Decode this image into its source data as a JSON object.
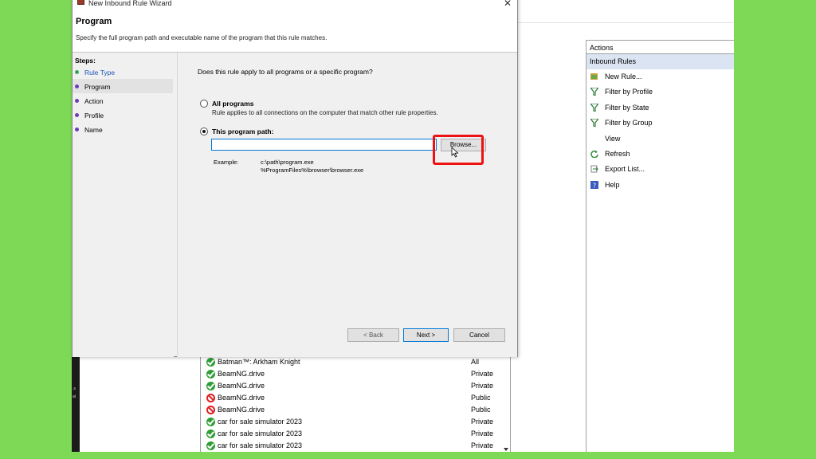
{
  "wizard": {
    "window_title": "New Inbound Rule Wizard",
    "close_glyph": "✕",
    "heading": "Program",
    "description": "Specify the full program path and executable name of the program that this rule matches.",
    "steps_label": "Steps:",
    "steps": [
      {
        "label": "Rule Type",
        "state": "done"
      },
      {
        "label": "Program",
        "state": "current"
      },
      {
        "label": "Action",
        "state": "todo"
      },
      {
        "label": "Profile",
        "state": "todo"
      },
      {
        "label": "Name",
        "state": "todo"
      }
    ],
    "question": "Does this rule apply to all programs or a specific program?",
    "option_all": {
      "label": "All programs",
      "description": "Rule applies to all connections on the computer that match other rule properties.",
      "selected": false
    },
    "option_path": {
      "label": "This program path:",
      "selected": true
    },
    "path_value": "",
    "browse_label": "Browse...",
    "example_label": "Example:",
    "example_1": "c:\\path\\program.exe",
    "example_2": "%ProgramFiles%\\browser\\browser.exe",
    "back_label": "< Back",
    "next_label": "Next >",
    "cancel_label": "Cancel",
    "highlight_color": "#ee1111"
  },
  "actions_pane": {
    "header": "Actions",
    "group": "Inbound Rules",
    "items": [
      {
        "label": "New Rule...",
        "icon": "new-rule-icon",
        "submenu": false
      },
      {
        "label": "Filter by Profile",
        "icon": "filter-icon",
        "submenu": true
      },
      {
        "label": "Filter by State",
        "icon": "filter-icon",
        "submenu": true
      },
      {
        "label": "Filter by Group",
        "icon": "filter-icon",
        "submenu": true
      },
      {
        "label": "View",
        "icon": "",
        "submenu": true
      },
      {
        "label": "Refresh",
        "icon": "refresh-icon",
        "submenu": false
      },
      {
        "label": "Export List...",
        "icon": "export-icon",
        "submenu": false
      },
      {
        "label": "Help",
        "icon": "help-icon",
        "submenu": false
      }
    ]
  },
  "rules": [
    {
      "name": "Batman™: Arkham Knight",
      "profile": "All",
      "enabled": true
    },
    {
      "name": "BeamNG.drive",
      "profile": "Private",
      "enabled": true
    },
    {
      "name": "BeamNG.drive",
      "profile": "Private",
      "enabled": true
    },
    {
      "name": "BeamNG.drive",
      "profile": "Public",
      "enabled": false
    },
    {
      "name": "BeamNG.drive",
      "profile": "Public",
      "enabled": false
    },
    {
      "name": "car for sale simulator 2023",
      "profile": "Private",
      "enabled": true
    },
    {
      "name": "car for sale simulator 2023",
      "profile": "Private",
      "enabled": true
    },
    {
      "name": "car for sale simulator 2023",
      "profile": "Private",
      "enabled": true
    }
  ],
  "colors": {
    "background": "#7ed957",
    "accent": "#0078d7",
    "actions_group_bg": "#dbe4f3",
    "enabled": "#2e9d35",
    "blocked": "#dd2222"
  }
}
